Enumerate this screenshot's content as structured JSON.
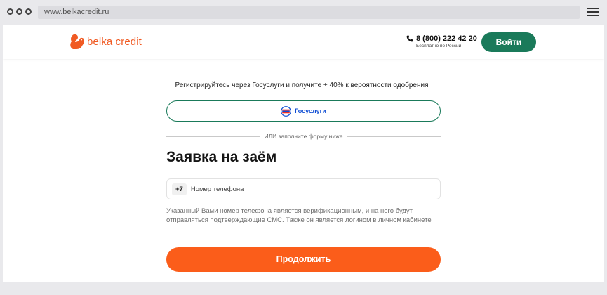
{
  "browser": {
    "url": "www.belkacredit.ru"
  },
  "header": {
    "logo_text": "belka credit",
    "phone": "8 (800) 222 42 20",
    "phone_subtitle": "Бесплатно по России",
    "login_label": "Войти"
  },
  "gosuslugi": {
    "hint": "Регистрируйтесь через Госуслуги и получите + 40% к вероятности одобрения",
    "button_label": "Госуслуги"
  },
  "form": {
    "divider_text": "ИЛИ заполните форму ниже",
    "title": "Заявка на заём",
    "phone_prefix": "+7",
    "phone_placeholder": "Номер телефона",
    "phone_value": "",
    "notice": "Указанный Вами номер телефона является верификационным, и на него будут отправляться подтверждающие СМС. Также он является логином в личном кабинете",
    "continue_label": "Продолжить"
  },
  "colors": {
    "brand_orange": "#fb5d1a",
    "brand_green": "#1a7a5a",
    "gosuslugi_blue": "#0d4cd3"
  },
  "icons": {
    "logo": "squirrel-icon",
    "phone": "phone-icon",
    "gosuslugi": "gosuslugi-logo-icon",
    "menu": "hamburger-icon"
  }
}
